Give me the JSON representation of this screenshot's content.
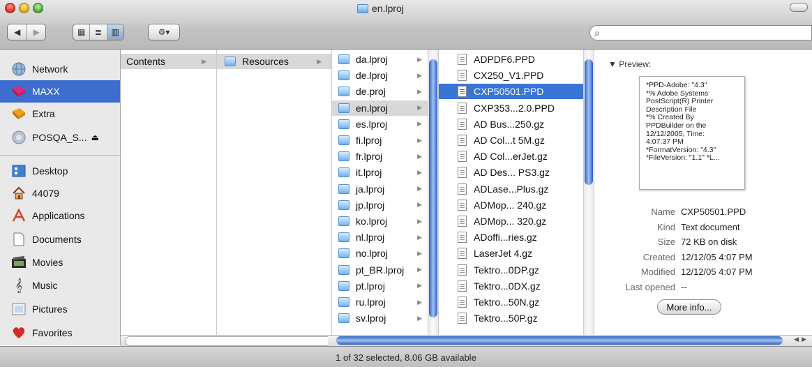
{
  "window": {
    "title": "en.lproj"
  },
  "toolbar": {
    "nav_buttons": [
      "◀",
      "▶"
    ],
    "view_buttons": [
      "▦",
      "≣",
      "▥"
    ],
    "action_glyph": "⚙▾",
    "search_glyph": "⌕"
  },
  "sidebar": {
    "devices": [
      {
        "label": "Network",
        "icon": "network-globe-icon"
      },
      {
        "label": "MAXX",
        "icon": "disk-icon"
      },
      {
        "label": "Extra",
        "icon": "disk-icon"
      },
      {
        "label": "POSQA_S...",
        "icon": "network-volume-icon",
        "eject": "⏏"
      }
    ],
    "places": [
      {
        "label": "Desktop",
        "icon": "desktop-icon"
      },
      {
        "label": "44079",
        "icon": "home-icon"
      },
      {
        "label": "Applications",
        "icon": "applications-icon"
      },
      {
        "label": "Documents",
        "icon": "documents-icon"
      },
      {
        "label": "Movies",
        "icon": "movies-icon"
      },
      {
        "label": "Music",
        "icon": "music-icon"
      },
      {
        "label": "Pictures",
        "icon": "pictures-icon"
      },
      {
        "label": "Favorites",
        "icon": "favorites-heart-icon"
      }
    ]
  },
  "columns": {
    "col1": [
      "Contents"
    ],
    "col2": [
      "Resources"
    ],
    "col3": [
      "da.lproj",
      "de.lproj",
      "de.proj",
      "en.lproj",
      "es.lproj",
      "fi.lproj",
      "fr.lproj",
      "it.lproj",
      "ja.lproj",
      "jp.lproj",
      "ko.lproj",
      "nl.lproj",
      "no.lproj",
      "pt_BR.lproj",
      "pt.lproj",
      "ru.lproj",
      "sv.lproj"
    ],
    "col4": [
      "ADPDF6.PPD",
      "CX250_V1.PPD",
      "CXP50501.PPD",
      "CXP353...2.0.PPD",
      "AD Bus...250.gz",
      "AD Col...t 5M.gz",
      "AD Col...erJet.gz",
      "AD Des... PS3.gz",
      "ADLase...Plus.gz",
      "ADMop... 240.gz",
      "ADMop... 320.gz",
      "ADoffi...ries.gz",
      "LaserJet 4.gz",
      "Tektro...0DP.gz",
      "Tektro...0DX.gz",
      "Tektro...50N.gz",
      "Tektro...50P.gz"
    ],
    "col3_selected": "en.lproj",
    "col4_selected": "CXP50501.PPD"
  },
  "preview": {
    "label": "Preview:",
    "text_lines": [
      "*PPD-Adobe: \"4.3\"",
      "*% Adobe Systems",
      "PostScript(R) Printer",
      "Description File",
      "*% Created By",
      "PPDBuilder on the",
      "12/12/2005, Time:",
      "4:07:37 PM",
      "*FormatVersion: \"4.3\"",
      "*FileVersion: \"1.1\"  *L..."
    ],
    "meta": [
      {
        "key": "Name",
        "value": "CXP50501.PPD"
      },
      {
        "key": "Kind",
        "value": "Text document"
      },
      {
        "key": "Size",
        "value": "72 KB on disk"
      },
      {
        "key": "Created",
        "value": "12/12/05 4:07 PM"
      },
      {
        "key": "Modified",
        "value": "12/12/05 4:07 PM"
      },
      {
        "key": "Last opened",
        "value": "--"
      }
    ],
    "more_info": "More info..."
  },
  "status": {
    "text": "1 of 32 selected, 8.06 GB available"
  }
}
